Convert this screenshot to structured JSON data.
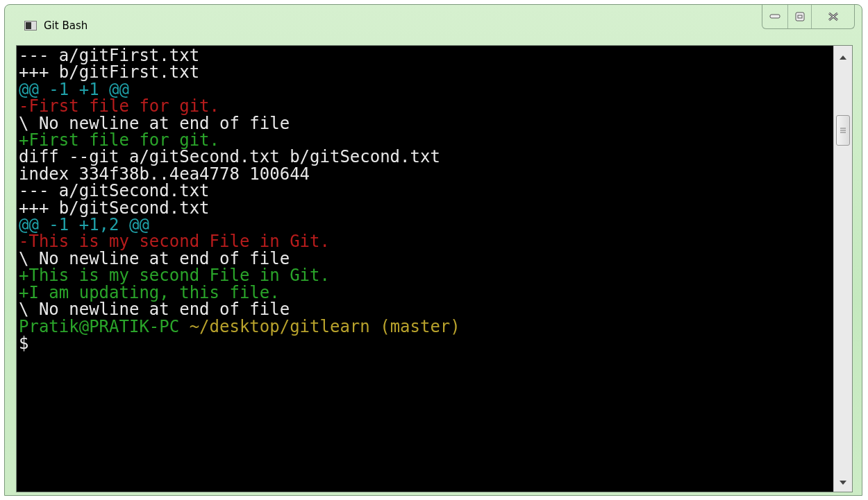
{
  "window": {
    "title": "Git Bash"
  },
  "terminal": {
    "lines": [
      {
        "kind": "plain",
        "text": "--- a/gitFirst.txt"
      },
      {
        "kind": "plain",
        "text": "+++ b/gitFirst.txt"
      },
      {
        "kind": "hunk",
        "text": "@@ -1 +1 @@"
      },
      {
        "kind": "removed",
        "text": "-First file for git."
      },
      {
        "kind": "plain",
        "text": "\\ No newline at end of file"
      },
      {
        "kind": "added",
        "text": "+First file for git."
      },
      {
        "kind": "plain",
        "text": "diff --git a/gitSecond.txt b/gitSecond.txt"
      },
      {
        "kind": "plain",
        "text": "index 334f38b..4ea4778 100644"
      },
      {
        "kind": "plain",
        "text": "--- a/gitSecond.txt"
      },
      {
        "kind": "plain",
        "text": "+++ b/gitSecond.txt"
      },
      {
        "kind": "hunk",
        "text": "@@ -1 +1,2 @@"
      },
      {
        "kind": "removed",
        "text": "-This is my second File in Git."
      },
      {
        "kind": "plain",
        "text": "\\ No newline at end of file"
      },
      {
        "kind": "added",
        "text": "+This is my second File in Git."
      },
      {
        "kind": "added",
        "text": "+I am updating, this file."
      },
      {
        "kind": "plain",
        "text": "\\ No newline at end of file"
      },
      {
        "kind": "prompt",
        "user": "Pratik@PRATIK-PC",
        "path": "~/desktop/gitlearn (master)"
      },
      {
        "kind": "input",
        "text": "$"
      }
    ]
  }
}
